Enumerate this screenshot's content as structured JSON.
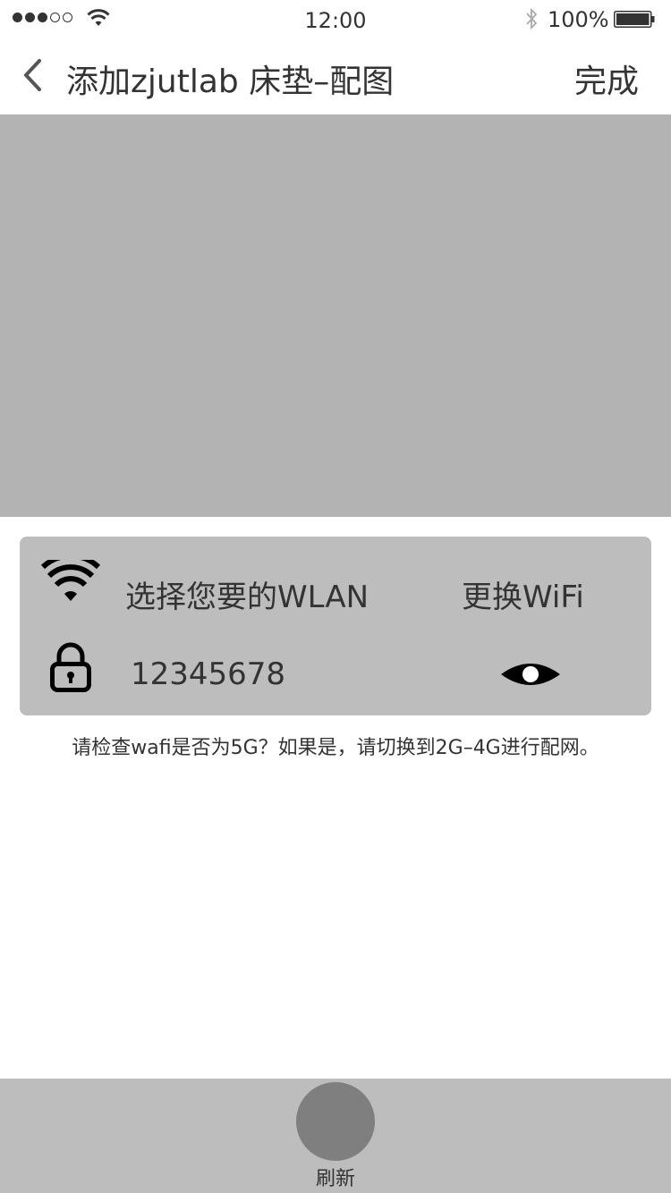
{
  "status_bar": {
    "time": "12:00",
    "battery": "100%",
    "signal_dots": 5,
    "signal_filled": 3,
    "icons": [
      "wifi-icon",
      "bluetooth-icon",
      "battery-icon"
    ]
  },
  "nav": {
    "title": "添加zjutlab 床垫–配图",
    "done_label": "完成",
    "back_icon": "chevron-left-icon"
  },
  "wifi_card": {
    "wlan_label": "选择您要的WLAN",
    "change_wifi_label": "更换WiFi",
    "password_value": "12345678",
    "icons": [
      "wifi-icon",
      "lock-icon",
      "eye-icon"
    ]
  },
  "hint": "请检查wafi是否为5G？如果是，请切换到2G–4G进行配网。",
  "bottom": {
    "refresh_label": "刷新"
  },
  "colors": {
    "preview_bg": "#b3b3b3",
    "card_bg": "#bdbdbd",
    "refresh_button": "#7f7f7f",
    "text": "#333333"
  }
}
